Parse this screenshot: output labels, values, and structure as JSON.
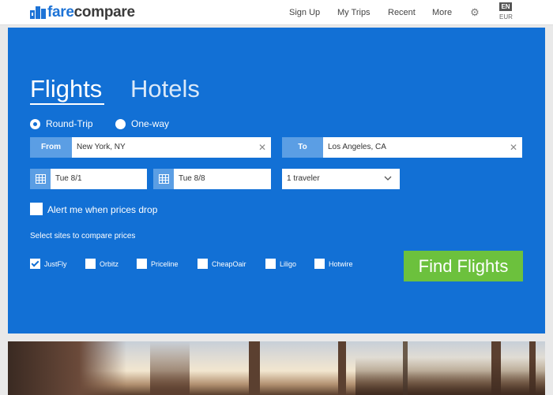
{
  "header": {
    "logo_fare": "fare",
    "logo_compare": "compare",
    "nav": [
      "Sign Up",
      "My Trips",
      "Recent",
      "More"
    ],
    "language": "EN",
    "currency": "EUR",
    "settings_icon": "gear-icon"
  },
  "search": {
    "tabs": {
      "flights": "Flights",
      "hotels": "Hotels",
      "active": "Flights"
    },
    "trip_type": {
      "round_trip": "Round-Trip",
      "one_way": "One-way",
      "selected": "Round-Trip"
    },
    "from_label": "From",
    "from_value": "New York, NY",
    "to_label": "To",
    "to_value": "Los Angeles, CA",
    "depart_date": "Tue 8/1",
    "return_date": "Tue 8/8",
    "travelers": "1 traveler",
    "alert_label": "Alert me when prices drop",
    "alert_checked": false,
    "compare_label": "Select sites to compare prices",
    "sites": [
      {
        "name": "JustFly",
        "checked": true
      },
      {
        "name": "Orbitz",
        "checked": false
      },
      {
        "name": "Priceline",
        "checked": false
      },
      {
        "name": "CheapOair",
        "checked": false
      },
      {
        "name": "Liligo",
        "checked": false
      },
      {
        "name": "Hotwire",
        "checked": false
      }
    ],
    "submit": "Find Flights",
    "clear_symbol": "✕"
  },
  "colors": {
    "brand_blue": "#1270d5",
    "label_blue": "#5b9ee4",
    "button_green": "#6cc13d"
  }
}
